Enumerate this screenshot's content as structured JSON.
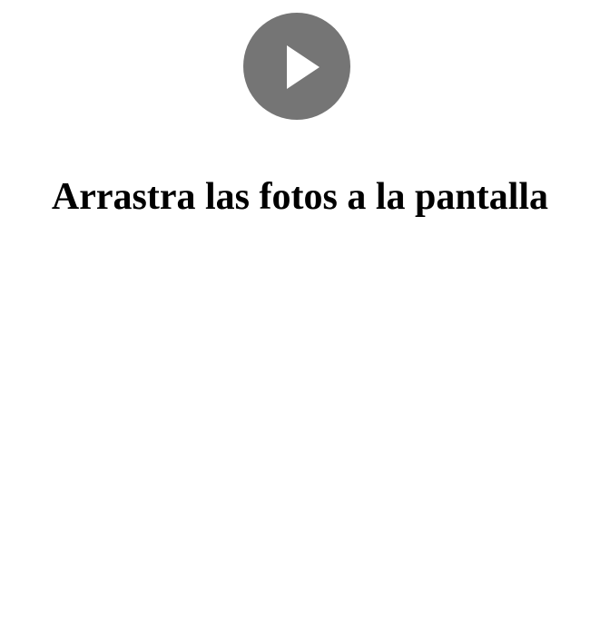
{
  "play_button": {
    "icon": "play-icon",
    "background_color": "#757575",
    "icon_color": "#ffffff"
  },
  "heading": {
    "text": "Arrastra las fotos a la pantalla"
  }
}
